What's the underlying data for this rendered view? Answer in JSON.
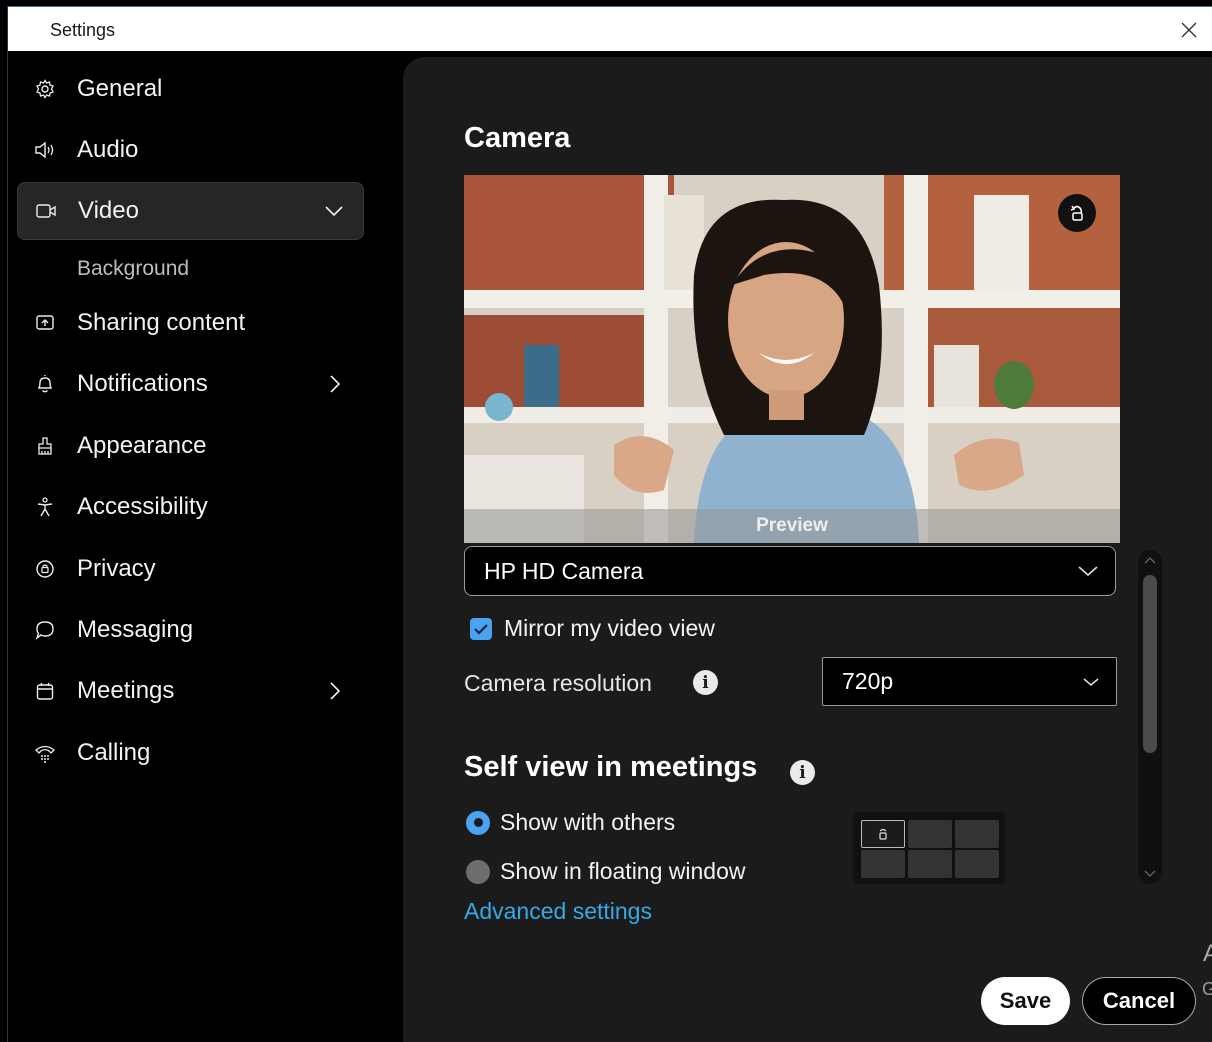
{
  "window": {
    "title": "Settings"
  },
  "sidebar": {
    "items": [
      {
        "label": "General",
        "icon": "gear-icon"
      },
      {
        "label": "Audio",
        "icon": "speaker-icon"
      },
      {
        "label": "Video",
        "icon": "video-camera-icon",
        "active": true,
        "expanded": true
      },
      {
        "label": "Sharing content",
        "icon": "share-screen-icon"
      },
      {
        "label": "Notifications",
        "icon": "bell-icon",
        "has_submenu": true
      },
      {
        "label": "Appearance",
        "icon": "paint-brush-icon"
      },
      {
        "label": "Accessibility",
        "icon": "accessibility-person-icon"
      },
      {
        "label": "Privacy",
        "icon": "privacy-badge-icon"
      },
      {
        "label": "Messaging",
        "icon": "chat-bubble-icon"
      },
      {
        "label": "Meetings",
        "icon": "calendar-icon",
        "has_submenu": true
      },
      {
        "label": "Calling",
        "icon": "phone-dialpad-icon"
      }
    ],
    "video_sub": {
      "label": "Background"
    }
  },
  "camera": {
    "heading": "Camera",
    "preview_label": "Preview",
    "device": "HP HD Camera",
    "mirror_label": "Mirror my video view",
    "mirror_checked": true,
    "resolution_label": "Camera resolution",
    "resolution_value": "720p",
    "info_glyph": "i"
  },
  "self_view": {
    "heading": "Self view in meetings",
    "options": [
      {
        "label": "Show with others",
        "selected": true
      },
      {
        "label": "Show in floating window",
        "selected": false
      }
    ]
  },
  "advanced_link": "Advanced settings",
  "footer": {
    "save": "Save",
    "cancel": "Cancel"
  },
  "edge_glyphs": {
    "a": "A",
    "g": "G"
  },
  "colors": {
    "accent": "#4aa3f0",
    "link": "#36a9e8",
    "panel": "#1b1b1b",
    "sidebar_active": "#262626"
  }
}
